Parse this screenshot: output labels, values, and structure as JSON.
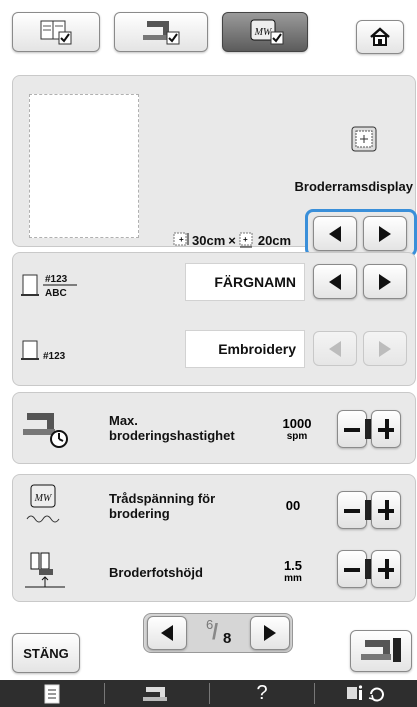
{
  "top_tabs": [
    {
      "name": "settings-general",
      "active": false
    },
    {
      "name": "settings-sewing",
      "active": false
    },
    {
      "name": "settings-embroidery",
      "active": true
    }
  ],
  "home_icon": "home-icon",
  "hoop_display": {
    "title": "Broderramsdisplay",
    "width_label": "30cm",
    "times": "×",
    "height_label": "20cm"
  },
  "color_name": {
    "value": "FÄRGNAMN",
    "icon_label_top": "#123",
    "icon_label_bottom": "ABC"
  },
  "thread_brand": {
    "value": "Embroidery",
    "icon_label": "#123",
    "arrows_disabled": true
  },
  "max_speed": {
    "label_line1": "Max.",
    "label_line2": "broderingshastighet",
    "value": "1000",
    "unit": "spm"
  },
  "tension": {
    "label_line1": "Trådspänning för",
    "label_line2": "brodering",
    "value": "00"
  },
  "foot_height": {
    "label": "Broderfotshöjd",
    "value": "1.5",
    "unit": "mm"
  },
  "pager": {
    "current": "6",
    "total": "8"
  },
  "close_label": "STÄNG",
  "bottom_bar": [
    {
      "icon": "document-icon"
    },
    {
      "icon": "sewing-machine-icon"
    },
    {
      "icon": "question-mark-icon",
      "label": "?"
    },
    {
      "icon": "settings-info-icon"
    }
  ],
  "colors": {
    "highlight": "#3a8fd9",
    "panel": "#e9e9e9",
    "bottom_bar": "#2e2e2e"
  }
}
